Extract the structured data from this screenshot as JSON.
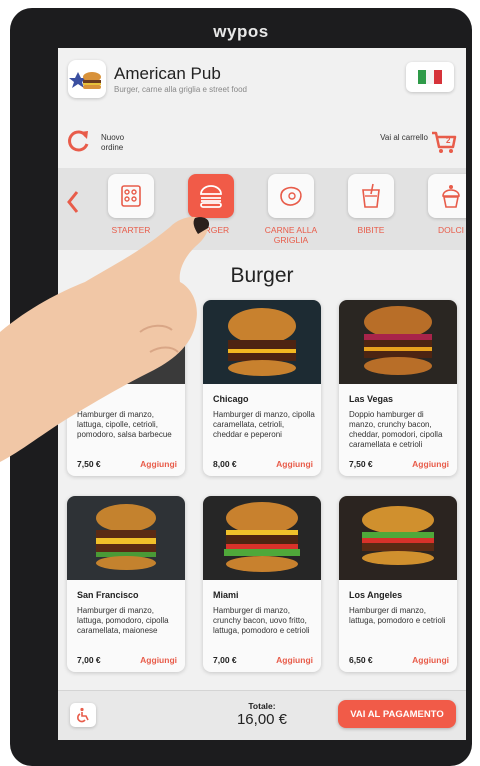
{
  "device_brand": "wypos",
  "store": {
    "name": "American Pub",
    "subtitle": "Burger, carne alla griglia e street food"
  },
  "language_flag": "italy-flag-icon",
  "actions": {
    "new_order": "Nuovo ordine",
    "cart": "Vai al carrello",
    "cart_count": "2"
  },
  "categories": [
    {
      "label": "STARTER",
      "icon": "starter-icon",
      "active": false
    },
    {
      "label": "BURGER",
      "icon": "burger-icon",
      "active": true
    },
    {
      "label": "CARNE ALLA GRIGLIA",
      "icon": "steak-icon",
      "active": false
    },
    {
      "label": "BIBITE",
      "icon": "drink-icon",
      "active": false
    },
    {
      "label": "DOLCI",
      "icon": "cupcake-icon",
      "active": false
    }
  ],
  "section_title": "Burger",
  "products": [
    {
      "name": "",
      "desc": "Hamburger di manzo, lattuga, cipolle, cetrioli, pomodoro, salsa barbecue",
      "price": "7,50 €",
      "add": "Aggiungi"
    },
    {
      "name": "Chicago",
      "desc": "Hamburger di manzo, cipolla caramellata, cetrioli, cheddar e peperoni",
      "price": "8,00 €",
      "add": "Aggiungi"
    },
    {
      "name": "Las Vegas",
      "desc": "Doppio hamburger di manzo, crunchy bacon, cheddar, pomodori, cipolla caramellata e cetrioli",
      "price": "7,50 €",
      "add": "Aggiungi"
    },
    {
      "name": "San Francisco",
      "desc": "Hamburger di manzo, lattuga, pomodoro, cipolla caramellata, maionese",
      "price": "7,00 €",
      "add": "Aggiungi"
    },
    {
      "name": "Miami",
      "desc": "Hamburger di manzo, crunchy bacon, uovo fritto, lattuga, pomodoro e cetrioli",
      "price": "7,00 €",
      "add": "Aggiungi"
    },
    {
      "name": "Los Angeles",
      "desc": "Hamburger di manzo, lattuga, pomodoro e cetrioli",
      "price": "6,50 €",
      "add": "Aggiungi"
    }
  ],
  "footer": {
    "total_label": "Totale:",
    "total_value": "16,00 €",
    "pay_label": "VAI AL PAGAMENTO"
  },
  "colors": {
    "accent": "#f15b48",
    "accent_text": "#e85c4a"
  }
}
